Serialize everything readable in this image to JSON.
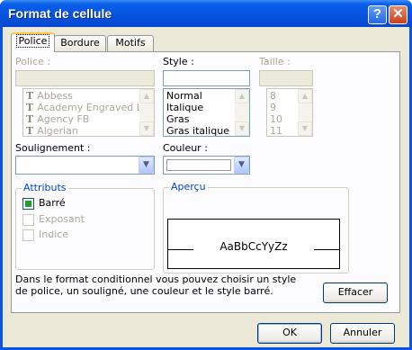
{
  "window": {
    "title": "Format de cellule",
    "help_icon": "?",
    "close_icon": "✕"
  },
  "tabs": [
    {
      "label": "Police",
      "active": true
    },
    {
      "label": "Bordure",
      "active": false
    },
    {
      "label": "Motifs",
      "active": false
    }
  ],
  "font": {
    "label": "Police :",
    "value": "",
    "items": [
      {
        "icon": "truetype-icon",
        "glyph": "T",
        "name": "Abbess"
      },
      {
        "icon": "truetype-icon",
        "glyph": "T",
        "name": "Academy Engraved LET"
      },
      {
        "icon": "truetype-icon",
        "glyph": "T",
        "name": "Agency FB"
      },
      {
        "icon": "truetype-icon",
        "glyph": "T",
        "name": "Algerian"
      }
    ]
  },
  "style": {
    "label": "Style :",
    "value": "",
    "items": [
      "Normal",
      "Italique",
      "Gras",
      "Gras italique"
    ]
  },
  "size": {
    "label": "Taille :",
    "value": "",
    "items": [
      "8",
      "9",
      "10",
      "11"
    ]
  },
  "underline": {
    "label": "Soulignement :",
    "value": ""
  },
  "color": {
    "label": "Couleur :",
    "value": ""
  },
  "attributes": {
    "title": "Attributs",
    "items": [
      {
        "label": "Barré",
        "checked": true,
        "enabled": true
      },
      {
        "label": "Exposant",
        "checked": false,
        "enabled": false
      },
      {
        "label": "Indice",
        "checked": false,
        "enabled": false
      }
    ]
  },
  "preview": {
    "title": "Aperçu",
    "sample": "AaBbCcYyZz"
  },
  "info_text": [
    "Dans le format conditionnel vous pouvez choisir un style",
    "de police, un souligné, une couleur et le style barré."
  ],
  "buttons": {
    "clear": "Effacer",
    "ok": "OK",
    "cancel": "Annuler"
  },
  "colors": {
    "title_bar": "#0553e0",
    "dialog_bg": "#ece9d8",
    "group_title": "#0046d5",
    "check_mark": "#21a121"
  }
}
